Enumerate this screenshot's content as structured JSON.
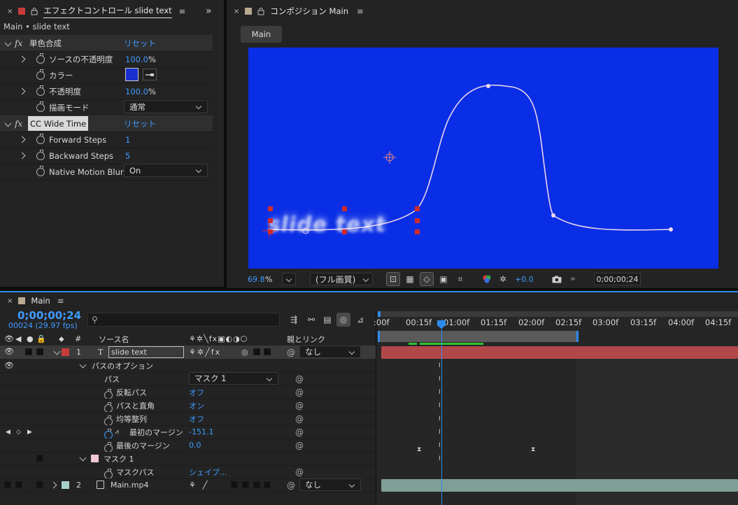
{
  "effect_panel": {
    "tab_title": "エフェクトコントロール slide text",
    "breadcrumb": "Main • slide text",
    "effects": [
      {
        "name": "単色合成",
        "reset": "リセット",
        "props": [
          {
            "label": "ソースの不透明度",
            "value": "100.0",
            "unit": "%"
          },
          {
            "label": "カラー",
            "color": "#1a2fd0"
          },
          {
            "label": "不透明度",
            "value": "100.0",
            "unit": "%"
          },
          {
            "label": "描画モード",
            "dropdown": "通常"
          }
        ]
      },
      {
        "name": "CC Wide Time",
        "reset": "リセット",
        "props": [
          {
            "label": "Forward Steps",
            "value": "1"
          },
          {
            "label": "Backward Steps",
            "value": "5"
          },
          {
            "label": "Native Motion Blur",
            "dropdown": "On"
          }
        ]
      }
    ]
  },
  "comp_panel": {
    "tab_title": "コンポジション Main",
    "comp_tab": "Main",
    "canvas_color": "#0a2ee6",
    "text_layer": "slide text",
    "zoom": "69.8",
    "zoom_unit": "%",
    "quality": "(フル画質)",
    "exposure": "+0.0",
    "timecode": "0;00;00;24"
  },
  "timeline": {
    "tab_title": "Main",
    "current_time": "0;00;00;24",
    "frame_info": "00024 (29.97 fps)",
    "search_placeholder": "",
    "col_hash": "#",
    "col_source": "ソース名",
    "col_parent": "親とリンク",
    "ruler_ticks": [
      ":00f",
      "00:15f",
      "01:00f",
      "01:15f",
      "02:00f",
      "02:15f",
      "03:00f",
      "03:15f",
      "04:00f",
      "04:15f"
    ],
    "layers": [
      {
        "num": "1",
        "name": "slide text",
        "label_color": "#c83c3c",
        "parent": "なし"
      },
      {
        "num": "2",
        "name": "Main.mp4",
        "label_color": "#a7d2cc",
        "parent": "なし"
      }
    ],
    "props": {
      "path_options": "パスのオプション",
      "path": "パス",
      "path_value": "マスク 1",
      "reverse": "反転パス",
      "reverse_value": "オフ",
      "perpendicular": "パスと直角",
      "perpendicular_value": "オン",
      "force_align": "均等整列",
      "force_align_value": "オフ",
      "first_margin": "最初のマージン",
      "first_margin_value": "-151.1",
      "last_margin": "最後のマージン",
      "last_margin_value": "0.0",
      "mask": "マスク 1",
      "mask_path": "マスクパス",
      "mask_path_value": "シェイプ..."
    }
  }
}
